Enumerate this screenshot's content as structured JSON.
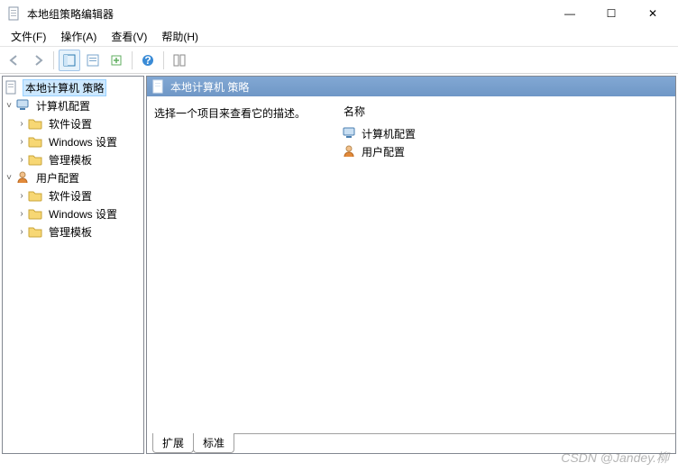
{
  "window": {
    "title": "本地组策略编辑器",
    "controls": {
      "min": "—",
      "max": "☐",
      "close": "✕"
    }
  },
  "menu": {
    "file": "文件(F)",
    "action": "操作(A)",
    "view": "查看(V)",
    "help": "帮助(H)"
  },
  "tree": {
    "root": "本地计算机 策略",
    "computer": "计算机配置",
    "user": "用户配置",
    "software": "软件设置",
    "windows": "Windows 设置",
    "admin": "管理模板"
  },
  "details": {
    "header": "本地计算机 策略",
    "prompt": "选择一个项目来查看它的描述。",
    "col_name": "名称",
    "item_computer": "计算机配置",
    "item_user": "用户配置"
  },
  "tabs": {
    "extended": "扩展",
    "standard": "标准"
  },
  "watermark": "CSDN @Jandey.柳"
}
